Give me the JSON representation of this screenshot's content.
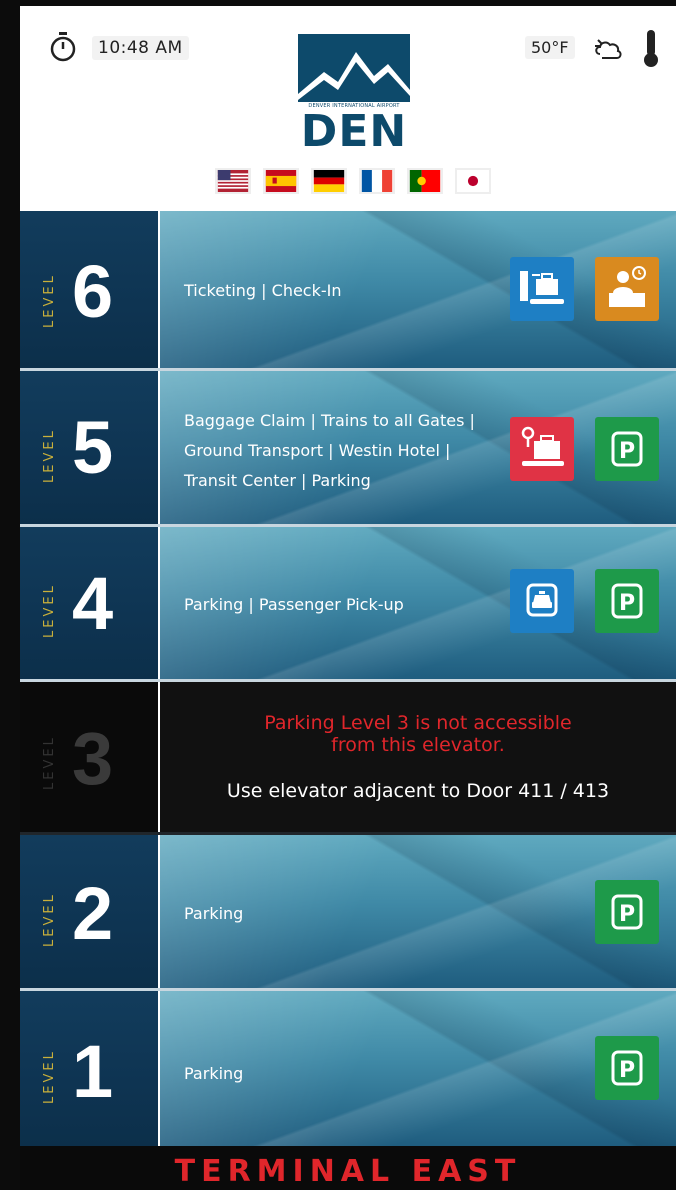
{
  "header": {
    "time": "10:48 AM",
    "temperature": "50°F",
    "logo_small_text": "DENVER INTERNATIONAL AIRPORT",
    "logo_text": "DEN",
    "icons": [
      "stopwatch-icon",
      "partly-cloudy-icon",
      "thermometer-icon"
    ],
    "languages": [
      "english-us-flag",
      "spanish-flag",
      "german-flag",
      "french-flag",
      "portuguese-flag",
      "japanese-flag"
    ]
  },
  "level_word": "LEVEL",
  "floors": [
    {
      "number": "6",
      "lines": [
        "Ticketing | Check-In"
      ],
      "icons": [
        "baggage-dropoff-icon",
        "check-in-counter-icon"
      ]
    },
    {
      "number": "5",
      "lines": [
        "Baggage Claim | Trains to all Gates |",
        "Ground Transport | Westin Hotel |",
        "Transit Center | Parking"
      ],
      "icons": [
        "baggage-claim-icon",
        "parking-icon"
      ]
    },
    {
      "number": "4",
      "lines": [
        "Parking | Passenger Pick-up"
      ],
      "icons": [
        "taxi-icon",
        "parking-icon"
      ]
    },
    {
      "number": "3",
      "warning_lines": [
        "Parking Level 3 is not accessible",
        "from this elevator."
      ],
      "note": "Use elevator adjacent to Door 411 / 413"
    },
    {
      "number": "2",
      "lines": [
        "Parking"
      ],
      "icons": [
        "parking-icon"
      ]
    },
    {
      "number": "1",
      "lines": [
        "Parking"
      ],
      "icons": [
        "parking-icon"
      ]
    }
  ],
  "footer": {
    "title": "TERMINAL EAST"
  },
  "colors": {
    "brand_navy": "#0d4a6b",
    "level_gold": "#c9b03b",
    "warning_red": "#e0262b",
    "icon_blue": "#1e7fc4",
    "icon_orange": "#d98a1f",
    "icon_red": "#e03345",
    "icon_green": "#1e9a4a"
  }
}
